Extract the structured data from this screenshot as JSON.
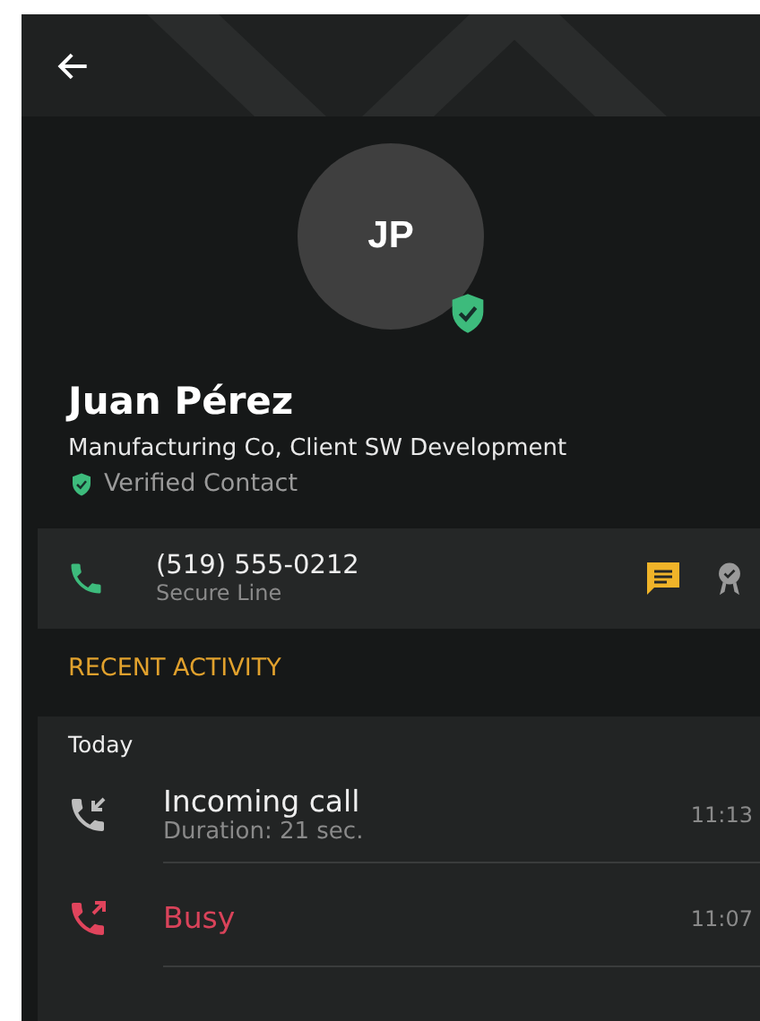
{
  "contact": {
    "initials": "JP",
    "verified": true,
    "name": "Juan Pérez",
    "subtitle": "Manufacturing Co, Client SW Development",
    "verified_label": "Verified Contact"
  },
  "phone": {
    "number": "(519) 555-0212",
    "label": "Secure Line"
  },
  "section_title": "RECENT ACTIVITY",
  "activity": {
    "day": "Today",
    "items": [
      {
        "kind": "incoming",
        "title": "Incoming call",
        "detail": "Duration: 21 sec.",
        "time": "11:13"
      },
      {
        "kind": "busy",
        "title": "Busy",
        "time": "11:07"
      }
    ]
  }
}
